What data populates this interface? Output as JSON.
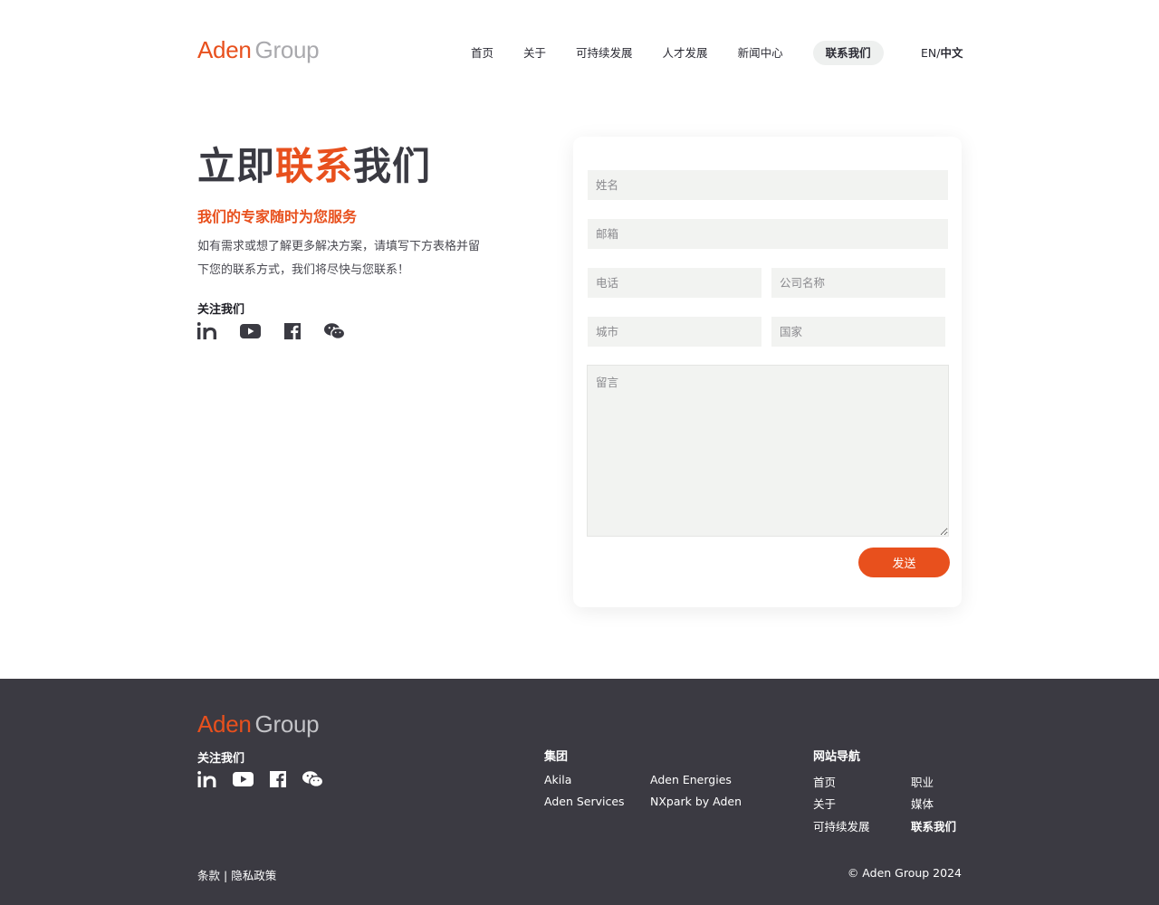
{
  "brand": {
    "logo_main": "Aden",
    "logo_sub": "Group",
    "accent_color": "#e8501d",
    "footer_bg": "#3b3a42"
  },
  "nav": {
    "items": [
      {
        "label": "首页"
      },
      {
        "label": "关于"
      },
      {
        "label": "可持续发展"
      },
      {
        "label": "人才发展"
      },
      {
        "label": "新闻中心"
      },
      {
        "label": "联系我们",
        "active": true
      }
    ],
    "lang_en": "EN/",
    "lang_cn": "中文"
  },
  "hero": {
    "title_before": "立即",
    "title_accent": "联系",
    "title_after": "我们",
    "subtitle": "我们的专家随时为您服务",
    "description": "如有需求或想了解更多解决方案，请填写下方表格并留下您的联系方式，我们将尽快与您联系！",
    "follow_label": "关注我们"
  },
  "socials": [
    {
      "icon": "linkedin-icon"
    },
    {
      "icon": "youtube-icon"
    },
    {
      "icon": "facebook-icon"
    },
    {
      "icon": "wechat-icon"
    }
  ],
  "form": {
    "name_placeholder": "姓名",
    "email_placeholder": "邮箱",
    "phone_placeholder": "电话",
    "company_placeholder": "公司名称",
    "city_placeholder": "城市",
    "country_placeholder": "国家",
    "message_placeholder": "留言",
    "submit_label": "发送"
  },
  "footer": {
    "follow_label": "关注我们",
    "group_title": "集团",
    "group_links": [
      "Akila",
      "Aden Energies",
      "Aden Services",
      "NXpark by Aden"
    ],
    "sitemap_title": "网站导航",
    "sitemap_links": [
      "首页",
      "职业",
      "关于",
      "媒体",
      "可持续发展",
      "联系我们"
    ],
    "terms": "条款",
    "separator": " | ",
    "privacy": "隐私政策",
    "copyright": "© Aden Group 2024"
  }
}
